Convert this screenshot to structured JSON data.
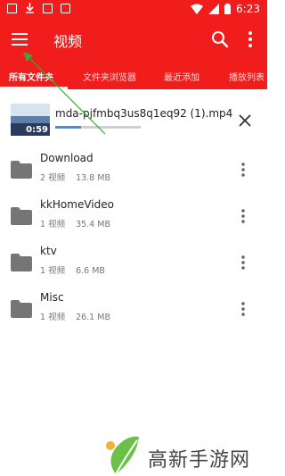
{
  "status_bar": {
    "time": "6:23",
    "icons": [
      "photo-icon",
      "download-icon",
      "app-icon",
      "notification-icon",
      "wifi-icon",
      "signal-icon",
      "battery-icon"
    ]
  },
  "toolbar": {
    "title": "视频",
    "icons": [
      "menu-icon",
      "search-icon",
      "more-vert-icon"
    ]
  },
  "tabs": [
    {
      "label": "所有文件夹",
      "active": true
    },
    {
      "label": "文件夹浏览器",
      "active": false
    },
    {
      "label": "最近添加",
      "active": false
    },
    {
      "label": "播放列表",
      "active": false
    }
  ],
  "recent_video": {
    "name": "mda-pjfmbq3us8q1eq92 (1).mp4",
    "duration": "0:59",
    "progress": 0.3
  },
  "folders": [
    {
      "name": "Download",
      "count": "2 视频",
      "size": "13.8 MB"
    },
    {
      "name": "kkHomeVideo",
      "count": "1 视频",
      "size": "35.4 MB"
    },
    {
      "name": "ktv",
      "count": "1 视频",
      "size": "6.6 MB"
    },
    {
      "name": "Misc",
      "count": "1 视频",
      "size": "26.1 MB"
    }
  ],
  "watermark": {
    "text": "高新手游网"
  },
  "colors": {
    "header": "#f11c1c",
    "progress": "#3b8ef0",
    "annotation_arrow": "#3aa83a",
    "folder_icon": "#757575"
  }
}
